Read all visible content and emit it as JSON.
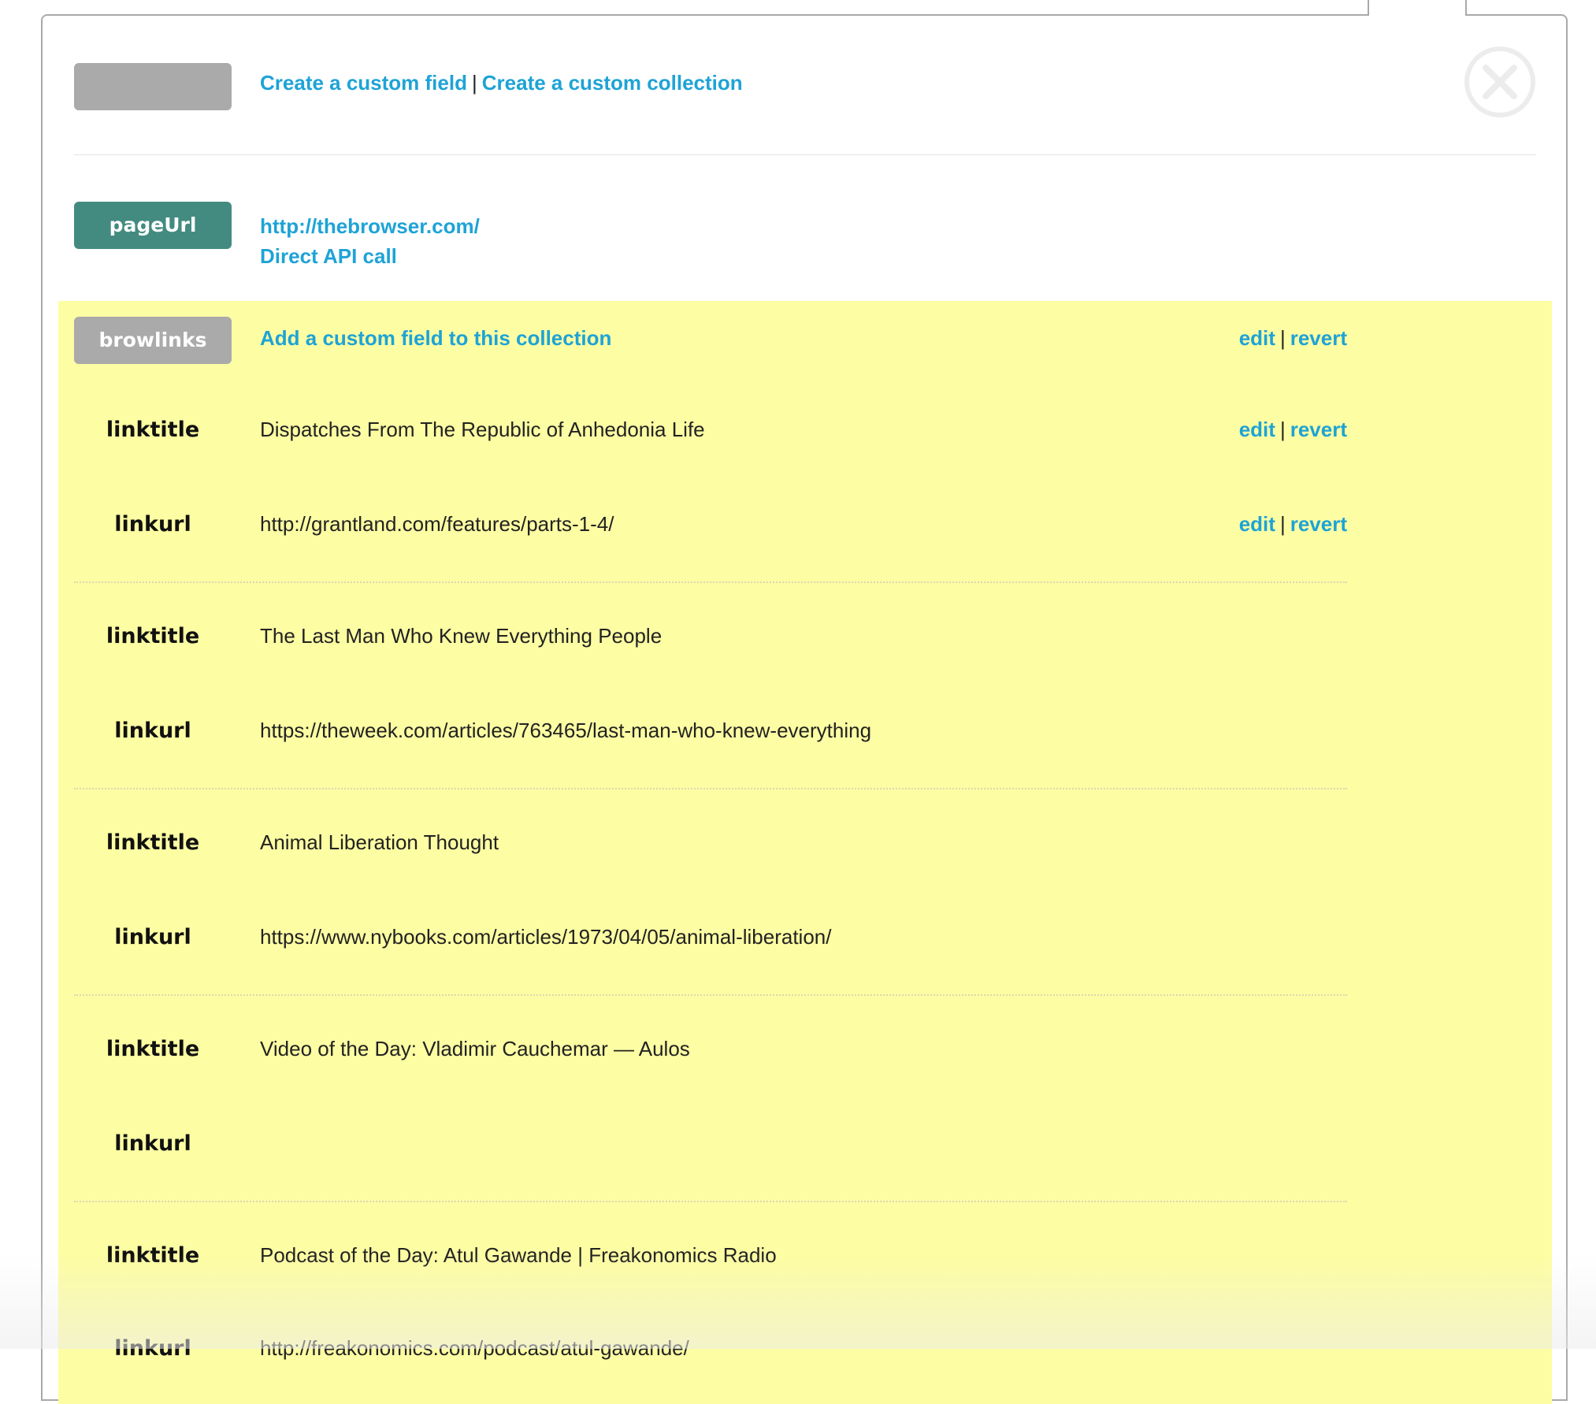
{
  "toolbar": {
    "create_field_label": "Create a custom field",
    "separator": "|",
    "create_collection_label": "Create a custom collection"
  },
  "page_field": {
    "name": "pageUrl",
    "url": "http://thebrowser.com/",
    "source": "Direct API call"
  },
  "collection": {
    "name": "browlinks",
    "add_field_label": "Add a custom field to this collection",
    "edit_label": "edit",
    "revert_label": "revert",
    "items": [
      {
        "linktitle_label": "linktitle",
        "linktitle": "Dispatches From The Republic of Anhedonia Life",
        "linkurl_label": "linkurl",
        "linkurl": "http://grantland.com/features/parts-1-4/"
      },
      {
        "linktitle_label": "linktitle",
        "linktitle": "The Last Man Who Knew Everything People",
        "linkurl_label": "linkurl",
        "linkurl": "https://theweek.com/articles/763465/last-man-who-knew-everything"
      },
      {
        "linktitle_label": "linktitle",
        "linktitle": "Animal Liberation Thought",
        "linkurl_label": "linkurl",
        "linkurl": "https://www.nybooks.com/articles/1973/04/05/animal-liberation/"
      },
      {
        "linktitle_label": "linktitle",
        "linktitle": "Video of the Day: Vladimir Cauchemar — Aulos",
        "linkurl_label": "linkurl",
        "linkurl": ""
      },
      {
        "linktitle_label": "linktitle",
        "linktitle": "Podcast of the Day: Atul Gawande | Freakonomics Radio",
        "linkurl_label": "linkurl",
        "linkurl": "http://freakonomics.com/podcast/atul-gawande/"
      }
    ]
  },
  "icons": {
    "close": "close-icon"
  },
  "colors": {
    "link": "#1ea3d6",
    "highlight": "#fdfda3",
    "teal": "#438b80",
    "gray_pill": "#aaaaaa"
  }
}
